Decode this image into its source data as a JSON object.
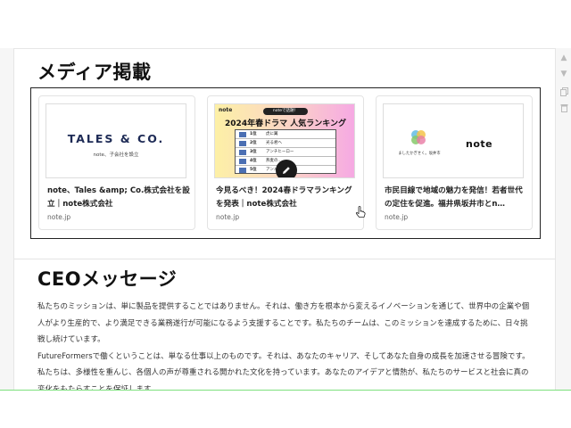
{
  "media": {
    "heading": "メディア掲載",
    "cards": [
      {
        "title": "note、Tales &amp; Co.株式会社を設立｜note株式会社",
        "domain": "note.jp",
        "thumb_logo": "TALES & CO.",
        "thumb_sub": "note、子会社を設立"
      },
      {
        "title": "今見るべき！2024春ドラマランキングを発表｜note株式会社",
        "domain": "note.jp",
        "thumb_brand": "note",
        "thumb_badge": "noteで話題！",
        "thumb_heading": "2024年春ドラマ 人気ランキング",
        "ranks": [
          {
            "rank": "1位",
            "name": "虎に翼"
          },
          {
            "rank": "2位",
            "name": "光る君へ"
          },
          {
            "rank": "3位",
            "name": "アンチヒーロー"
          },
          {
            "rank": "4位",
            "name": "燕麦の…"
          },
          {
            "rank": "5位",
            "name": "アンメット"
          }
        ]
      },
      {
        "title": "市民目線で地域の魅力を発信！若者世代の定住を促進。福井県坂井市とn…",
        "domain": "note.jp",
        "thumb_city_text": "ましたかぎせく。坂井市",
        "thumb_brand": "note"
      }
    ]
  },
  "ceo": {
    "heading": "CEOメッセージ",
    "paragraph1": "私たちのミッションは、単に製品を提供することではありません。それは、働き方を根本から変えるイノベーションを通じて、世界中の企業や個人がより生産的で、より満足できる業務遂行が可能になるよう支援することです。私たちのチームは、このミッションを達成するために、日々挑戦し続けています。",
    "paragraph2": "FutureFormersで働くということは、単なる仕事以上のものです。それは、あなたのキャリア、そしてあなた自身の成長を加速させる冒険です。私たちは、多様性を重んじ、各個人の声が尊重される開かれた文化を持っています。あなたのアイデアと情熱が、私たちのサービスと社会に真の変化をもたらすことを保証します。"
  },
  "colors": {
    "accent_outline": "#222222",
    "tales_navy": "#1d2a55",
    "drama_gradient_start": "#fdf0a6",
    "drama_gradient_end": "#f6a8e4",
    "fab_bg": "#1b1b1b",
    "green_line": "#7de07d"
  },
  "icons": {
    "edit": "pencil-icon",
    "cursor": "hand-pointer-icon",
    "side_tools": [
      "arrow-up-icon",
      "arrow-down-icon",
      "copy-icon",
      "trash-icon"
    ]
  }
}
